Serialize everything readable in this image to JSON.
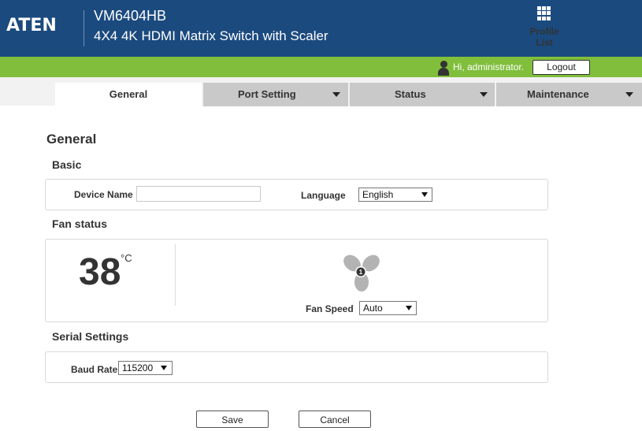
{
  "header": {
    "logo": "ATEN",
    "model": "VM6404HB",
    "subtitle": "4X4 4K HDMI Matrix Switch with Scaler",
    "profile_label": "Profile List"
  },
  "userbar": {
    "greeting": "Hi, administrator.",
    "logout_label": "Logout"
  },
  "tabs": [
    {
      "label": "General",
      "active": true
    },
    {
      "label": "Port Setting",
      "active": false
    },
    {
      "label": "Status",
      "active": false
    },
    {
      "label": "Maintenance",
      "active": false
    }
  ],
  "page": {
    "title": "General",
    "basic": {
      "title": "Basic",
      "device_name_label": "Device Name",
      "device_name_value": "",
      "language_label": "Language",
      "language_value": "English"
    },
    "fan": {
      "title": "Fan status",
      "temperature": "38",
      "unit": "°C",
      "fan_number": "1",
      "fan_speed_label": "Fan Speed",
      "fan_speed_value": "Auto"
    },
    "serial": {
      "title": "Serial Settings",
      "baud_rate_label": "Baud Rate",
      "baud_rate_value": "115200"
    },
    "save_label": "Save",
    "cancel_label": "Cancel"
  },
  "colors": {
    "header_bg": "#1b4a7e",
    "green_bar": "#80be3c",
    "tab_inactive": "#c9c9c9",
    "fan_icon": "#b3b3b3"
  },
  "icons": [
    "aten-logo",
    "profile-list-icon",
    "user-icon",
    "chevron-down-icon",
    "fan-icon"
  ]
}
